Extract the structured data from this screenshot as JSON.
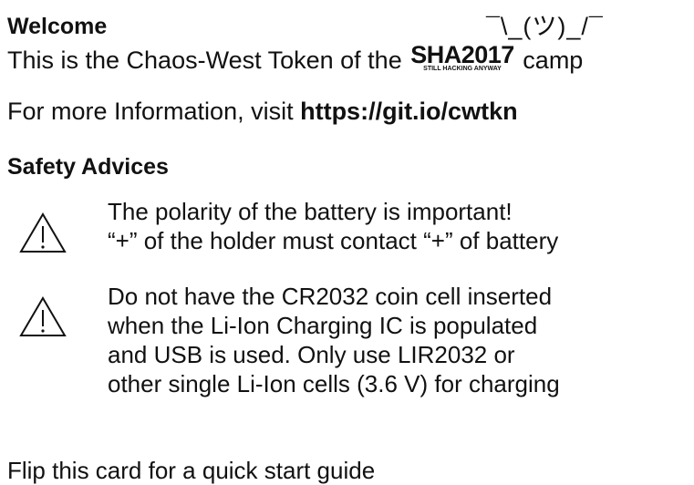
{
  "welcome": {
    "heading": "Welcome",
    "shrug": "¯\\_(ツ)_/¯",
    "intro_before": "This is the Chaos-West Token of the ",
    "logo_main": "SHA2017",
    "logo_sub": "STILL HACKING ANYWAY",
    "intro_after": " camp",
    "info_prefix": "For more Information, visit ",
    "info_link": "https://git.io/cwtkn"
  },
  "safety": {
    "heading": "Safety Advices",
    "advices": [
      {
        "icon": "warning-triangle-icon",
        "lines": [
          "The polarity of the battery is important!",
          "“+” of the holder must contact “+” of battery"
        ]
      },
      {
        "icon": "warning-triangle-icon",
        "lines": [
          "Do not have the CR2032 coin cell inserted",
          "when the Li-Ion Charging IC is populated",
          "and USB is used. Only use LIR2032 or",
          "other single Li-Ion cells (3.6 V) for charging"
        ]
      }
    ]
  },
  "footer": {
    "text": "Flip this card for a quick start guide"
  }
}
